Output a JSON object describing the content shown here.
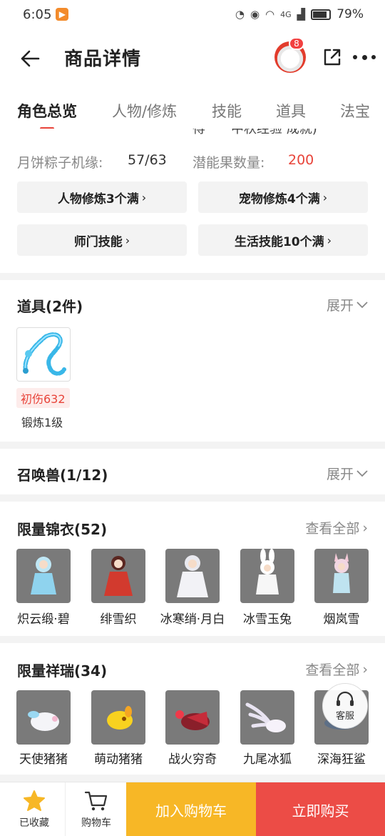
{
  "status_bar": {
    "time": "6:05",
    "network": "4G",
    "battery": "79%"
  },
  "header": {
    "title": "商品详情",
    "notification_count": "8"
  },
  "tabs": [
    {
      "label": "角色总览"
    },
    {
      "label": "人物/修炼"
    },
    {
      "label": "技能"
    },
    {
      "label": "道具"
    },
    {
      "label": "法宝"
    }
  ],
  "overview": {
    "clipped_text": "得　　中秋经验 成就)",
    "stats": [
      {
        "label": "月饼粽子机缘:",
        "value": "57/63"
      },
      {
        "label": "潜能果数量:",
        "value": "200"
      }
    ],
    "pills": [
      {
        "label": "人物修炼3个满"
      },
      {
        "label": "宠物修炼4个满"
      },
      {
        "label": "师门技能"
      },
      {
        "label": "生活技能10个满"
      }
    ]
  },
  "items_section": {
    "title": "道具(2件)",
    "action": "展开",
    "item": {
      "tag": "初伤632",
      "caption": "锻炼1级"
    }
  },
  "pets_section": {
    "title": "召唤兽(1/12)",
    "action": "展开"
  },
  "outfits_section": {
    "title": "限量锦衣(52)",
    "action": "查看全部",
    "items": [
      {
        "name": "炽云缎·碧"
      },
      {
        "name": "绯雪织"
      },
      {
        "name": "冰寒绡·月白"
      },
      {
        "name": "冰雪玉兔"
      },
      {
        "name": "烟岚雪"
      }
    ]
  },
  "mounts_section": {
    "title": "限量祥瑞(34)",
    "action": "查看全部",
    "items": [
      {
        "name": "天使猪猪"
      },
      {
        "name": "萌动猪猪"
      },
      {
        "name": "战火穷奇"
      },
      {
        "name": "九尾冰狐"
      },
      {
        "name": "深海狂鲨"
      }
    ]
  },
  "service": {
    "label": "客服"
  },
  "bottom_bar": {
    "favorite": "已收藏",
    "cart": "购物车",
    "add_to_cart": "加入购物车",
    "buy_now": "立即购买"
  },
  "colors": {
    "accent_red": "#e8443a",
    "cart_yellow": "#f7b726",
    "buy_red": "#ec4c46"
  }
}
